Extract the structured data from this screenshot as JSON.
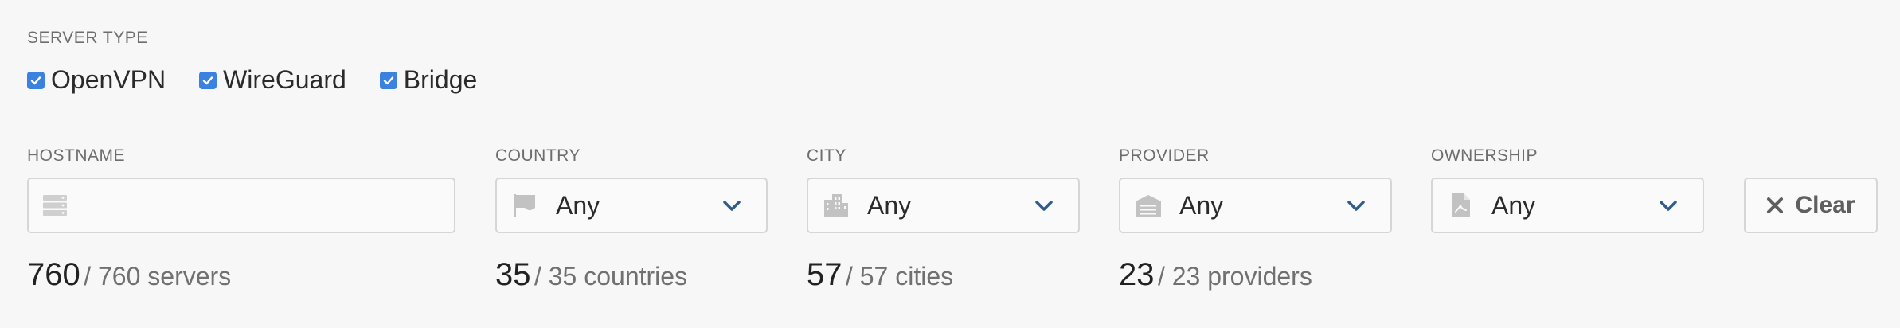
{
  "server_type": {
    "label": "SERVER TYPE",
    "options": [
      {
        "label": "OpenVPN",
        "checked": true
      },
      {
        "label": "WireGuard",
        "checked": true
      },
      {
        "label": "Bridge",
        "checked": true
      }
    ]
  },
  "filters": {
    "hostname": {
      "label": "HOSTNAME",
      "value": "",
      "placeholder": ""
    },
    "country": {
      "label": "COUNTRY",
      "value": "Any",
      "icon": "flag-icon"
    },
    "city": {
      "label": "CITY",
      "value": "Any",
      "icon": "city-buildings-icon"
    },
    "provider": {
      "label": "PROVIDER",
      "value": "Any",
      "icon": "warehouse-icon"
    },
    "ownership": {
      "label": "OWNERSHIP",
      "value": "Any",
      "icon": "document-icon"
    },
    "clear_label": "Clear"
  },
  "counts": {
    "servers": {
      "shown": "760",
      "rest": "/ 760 servers"
    },
    "countries": {
      "shown": "35",
      "rest": "/ 35 countries"
    },
    "cities": {
      "shown": "57",
      "rest": "/ 57 cities"
    },
    "providers": {
      "shown": "23",
      "rest": "/ 23 providers"
    }
  },
  "colors": {
    "accent": "#3b82e0",
    "chevron": "#2f5c8a",
    "icon": "#c2c2c2"
  }
}
